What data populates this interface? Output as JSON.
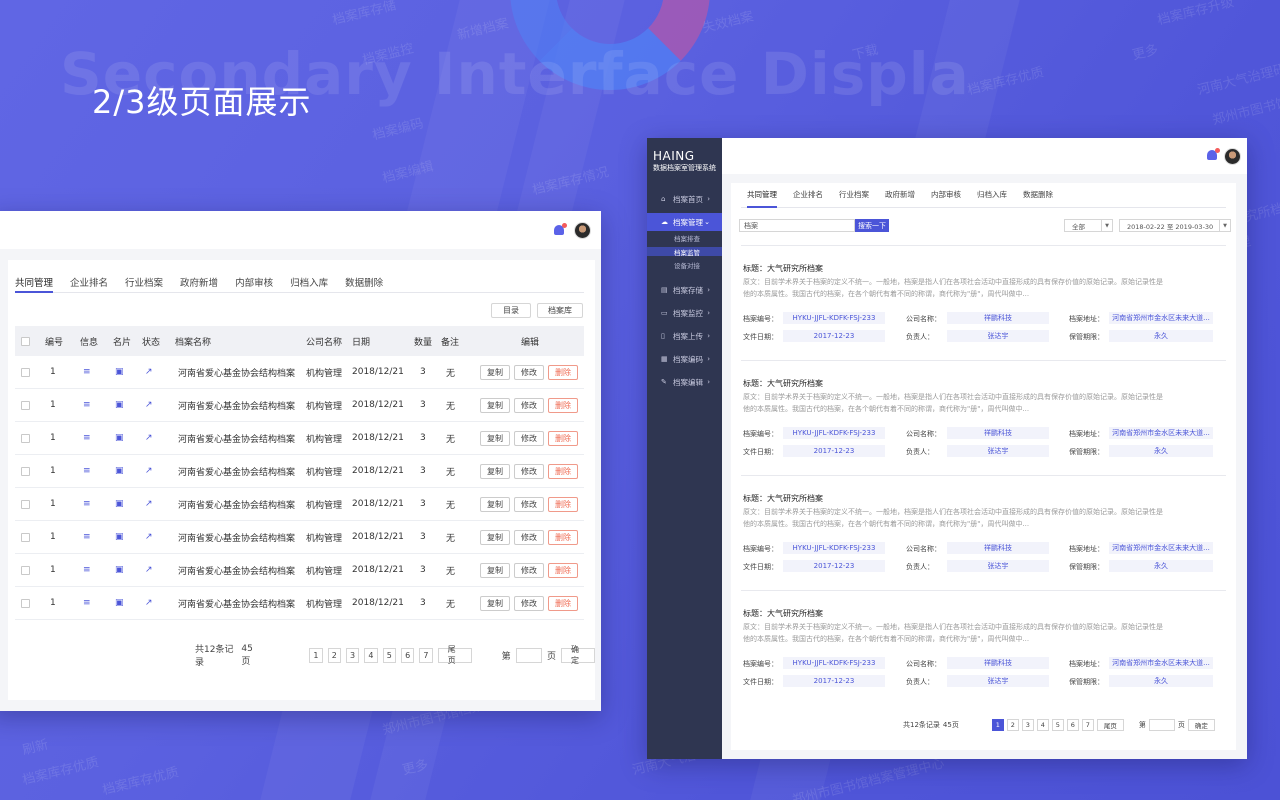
{
  "background": {
    "big_title": "Secondary Interface Displa",
    "heading": "2/3级页面展示",
    "watermarks": [
      "档案库存储",
      "新增档案",
      "失效档案",
      "档案库存升级",
      "档案监控",
      "下载",
      "河南大气治理研究所档案",
      "档案库存优质",
      "郑州市图书馆档案管理中心",
      "档案编码",
      "档案编辑",
      "档案库存情况",
      "更多",
      "研究所档案",
      "究管理",
      "下载",
      "刷新",
      "档案库存优质",
      "河南大气治理研究所档案",
      "郑州市图书馆档案管理中心",
      "更多",
      "档案库存优质",
      "郑州市图书馆档案管理中心"
    ]
  },
  "left_window": {
    "tabs": [
      "共同管理",
      "企业排名",
      "行业档案",
      "政府新增",
      "内部审核",
      "归档入库",
      "数据删除"
    ],
    "buttons": {
      "catalog": "目录",
      "archive_lib": "档案库"
    },
    "columns": [
      "编号",
      "信息",
      "名片",
      "状态",
      "档案名称",
      "公司名称",
      "日期",
      "数量",
      "备注",
      "编辑"
    ],
    "rows": [
      {
        "id": "1",
        "name": "河南省爱心基金协会结构档案",
        "company": "机构管理",
        "date": "2018/12/21",
        "qty": "3",
        "note": "无"
      },
      {
        "id": "1",
        "name": "河南省爱心基金协会结构档案",
        "company": "机构管理",
        "date": "2018/12/21",
        "qty": "3",
        "note": "无"
      },
      {
        "id": "1",
        "name": "河南省爱心基金协会结构档案",
        "company": "机构管理",
        "date": "2018/12/21",
        "qty": "3",
        "note": "无"
      },
      {
        "id": "1",
        "name": "河南省爱心基金协会结构档案",
        "company": "机构管理",
        "date": "2018/12/21",
        "qty": "3",
        "note": "无"
      },
      {
        "id": "1",
        "name": "河南省爱心基金协会结构档案",
        "company": "机构管理",
        "date": "2018/12/21",
        "qty": "3",
        "note": "无"
      },
      {
        "id": "1",
        "name": "河南省爱心基金协会结构档案",
        "company": "机构管理",
        "date": "2018/12/21",
        "qty": "3",
        "note": "无"
      },
      {
        "id": "1",
        "name": "河南省爱心基金协会结构档案",
        "company": "机构管理",
        "date": "2018/12/21",
        "qty": "3",
        "note": "无"
      },
      {
        "id": "1",
        "name": "河南省爱心基金协会结构档案",
        "company": "机构管理",
        "date": "2018/12/21",
        "qty": "3",
        "note": "无"
      }
    ],
    "actions": {
      "copy": "复制",
      "edit": "修改",
      "delete": "删除"
    },
    "pagination": {
      "total": "共12条记录",
      "pages": "45页",
      "numbers": [
        "1",
        "2",
        "3",
        "4",
        "5",
        "6",
        "7"
      ],
      "last": "尾页",
      "goto": "第",
      "page_unit": "页",
      "confirm": "确定"
    }
  },
  "right_window": {
    "logo": "HAING",
    "subtitle": "数据档案室管理系统",
    "menu": [
      {
        "icon": "⌂",
        "label": "档案首页"
      },
      {
        "icon": "☁",
        "label": "档案管理"
      },
      {
        "icon": "▤",
        "label": "档案存储"
      },
      {
        "icon": "▭",
        "label": "档案监控"
      },
      {
        "icon": "▯",
        "label": "档案上传"
      },
      {
        "icon": "▦",
        "label": "档案编码"
      },
      {
        "icon": "✎",
        "label": "档案编辑"
      }
    ],
    "submenu": [
      "档案排查",
      "档案监管",
      "设备对接"
    ],
    "tabs": [
      "共同管理",
      "企业排名",
      "行业档案",
      "政府新增",
      "内部审核",
      "归档入库",
      "数据删除"
    ],
    "search": {
      "value": "档案",
      "button": "搜索一下",
      "select": "全部",
      "date_range": "2018-02-22 至 2019-03-30"
    },
    "records": [
      {
        "title": "标题：大气研究所档案",
        "desc": "原文：目前学术界关于档案的定义不统一。一般地，档案是指人们在各项社会活动中直接形成的具有保存价值的原始记录。原始记录性是他的本质属性。我国古代的档案，在各个朝代有着不同的称谓，商代称为\"册\"，周代叫做中...",
        "code_label": "档案编号：",
        "code": "HYKU-JJFL-KDFK-FSJ-233",
        "company_label": "公司名称：",
        "company": "祥鹏科技",
        "addr_label": "档案地址：",
        "addr": "河南省郑州市金水区未来大道...",
        "date_label": "文件日期：",
        "date": "2017-12-23",
        "owner_label": "负责人：",
        "owner": "张达宇",
        "period_label": "保管期限：",
        "period": "永久"
      },
      {
        "title": "标题：大气研究所档案",
        "desc": "原文：目前学术界关于档案的定义不统一。一般地，档案是指人们在各项社会活动中直接形成的具有保存价值的原始记录。原始记录性是他的本质属性。我国古代的档案，在各个朝代有着不同的称谓，商代称为\"册\"，周代叫做中...",
        "code_label": "档案编号：",
        "code": "HYKU-JJFL-KDFK-FSJ-233",
        "company_label": "公司名称：",
        "company": "祥鹏科技",
        "addr_label": "档案地址：",
        "addr": "河南省郑州市金水区未来大道...",
        "date_label": "文件日期：",
        "date": "2017-12-23",
        "owner_label": "负责人：",
        "owner": "张达宇",
        "period_label": "保管期限：",
        "period": "永久"
      },
      {
        "title": "标题：大气研究所档案",
        "desc": "原文：目前学术界关于档案的定义不统一。一般地，档案是指人们在各项社会活动中直接形成的具有保存价值的原始记录。原始记录性是他的本质属性。我国古代的档案，在各个朝代有着不同的称谓，商代称为\"册\"，周代叫做中...",
        "code_label": "档案编号：",
        "code": "HYKU-JJFL-KDFK-FSJ-233",
        "company_label": "公司名称：",
        "company": "祥鹏科技",
        "addr_label": "档案地址：",
        "addr": "河南省郑州市金水区未来大道...",
        "date_label": "文件日期：",
        "date": "2017-12-23",
        "owner_label": "负责人：",
        "owner": "张达宇",
        "period_label": "保管期限：",
        "period": "永久"
      },
      {
        "title": "标题：大气研究所档案",
        "desc": "原文：目前学术界关于档案的定义不统一。一般地，档案是指人们在各项社会活动中直接形成的具有保存价值的原始记录。原始记录性是他的本质属性。我国古代的档案，在各个朝代有着不同的称谓，商代称为\"册\"，周代叫做中...",
        "code_label": "档案编号：",
        "code": "HYKU-JJFL-KDFK-FSJ-233",
        "company_label": "公司名称：",
        "company": "祥鹏科技",
        "addr_label": "档案地址：",
        "addr": "河南省郑州市金水区未来大道...",
        "date_label": "文件日期：",
        "date": "2017-12-23",
        "owner_label": "负责人：",
        "owner": "张达宇",
        "period_label": "保管期限：",
        "period": "永久"
      }
    ],
    "pagination": {
      "total": "共12条记录",
      "pages": "45页",
      "numbers": [
        "1",
        "2",
        "3",
        "4",
        "5",
        "6",
        "7"
      ],
      "last": "尾页",
      "goto": "第",
      "page_unit": "页",
      "confirm": "确定"
    }
  },
  "colors": {
    "accent": "#4b55d8",
    "sidebar": "#2f3651",
    "delete": "#ef6a52"
  }
}
